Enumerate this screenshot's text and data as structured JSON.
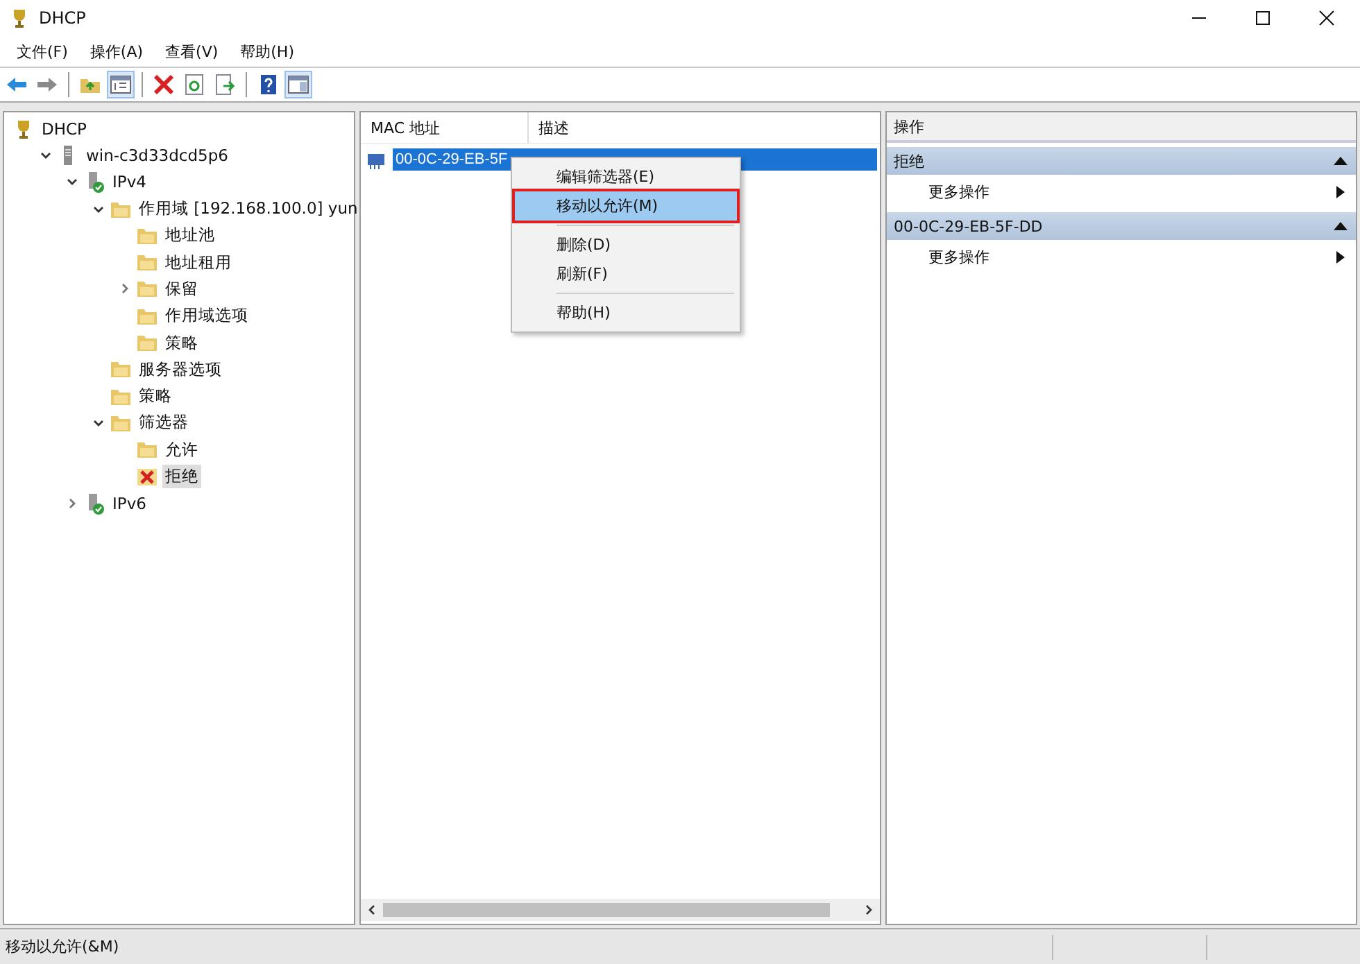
{
  "window": {
    "title": "DHCP"
  },
  "menu": [
    "文件(F)",
    "操作(A)",
    "查看(V)",
    "帮助(H)"
  ],
  "toolbar": [
    {
      "kind": "back",
      "pressed": false
    },
    {
      "kind": "forward",
      "pressed": false
    },
    {
      "kind": "sep"
    },
    {
      "kind": "up",
      "pressed": false
    },
    {
      "kind": "tree",
      "pressed": true
    },
    {
      "kind": "sep"
    },
    {
      "kind": "delete",
      "pressed": false
    },
    {
      "kind": "refresh",
      "pressed": false
    },
    {
      "kind": "export",
      "pressed": false
    },
    {
      "kind": "sep"
    },
    {
      "kind": "help",
      "pressed": false
    },
    {
      "kind": "pane",
      "pressed": true
    }
  ],
  "tree": [
    {
      "label": "DHCP",
      "kind": "root",
      "selected": false,
      "children": [
        {
          "label": "win-c3d33dcd5p6",
          "kind": "server",
          "selected": false,
          "expanded": true,
          "children": [
            {
              "label": "IPv4",
              "kind": "ip",
              "selected": false,
              "expanded": true,
              "children": [
                {
                  "label": "作用域 [192.168.100.0] yun",
                  "kind": "folder",
                  "selected": false,
                  "expanded": true,
                  "children": [
                    {
                      "label": "地址池",
                      "kind": "folder",
                      "selected": false
                    },
                    {
                      "label": "地址租用",
                      "kind": "folder",
                      "selected": false
                    },
                    {
                      "label": "保留",
                      "kind": "folder",
                      "selected": false,
                      "expanded": false
                    },
                    {
                      "label": "作用域选项",
                      "kind": "folder",
                      "selected": false
                    },
                    {
                      "label": "策略",
                      "kind": "folder",
                      "selected": false
                    }
                  ]
                },
                {
                  "label": "服务器选项",
                  "kind": "folder",
                  "selected": false
                },
                {
                  "label": "策略",
                  "kind": "folder",
                  "selected": false
                },
                {
                  "label": "筛选器",
                  "kind": "folder",
                  "selected": false,
                  "expanded": true,
                  "children": [
                    {
                      "label": "允许",
                      "kind": "folder",
                      "selected": false
                    },
                    {
                      "label": "拒绝",
                      "kind": "deny",
                      "selected": true
                    }
                  ]
                }
              ]
            },
            {
              "label": "IPv6",
              "kind": "ip",
              "selected": false,
              "expanded": false
            }
          ]
        }
      ]
    }
  ],
  "list": {
    "columns": [
      "MAC 地址",
      "描述"
    ],
    "rows": [
      {
        "mac": "00-0C-29-EB-5F",
        "selected": true
      }
    ]
  },
  "context_menu": [
    {
      "kind": "item",
      "label": "编辑筛选器(E)",
      "selected": false
    },
    {
      "kind": "item",
      "label": "移动以允许(M)",
      "selected": true
    },
    {
      "kind": "separator"
    },
    {
      "kind": "item",
      "label": "删除(D)",
      "selected": false
    },
    {
      "kind": "item",
      "label": "刷新(F)",
      "selected": false
    },
    {
      "kind": "separator"
    },
    {
      "kind": "item",
      "label": "帮助(H)",
      "selected": false
    }
  ],
  "actions": {
    "title": "操作",
    "sections": [
      {
        "title": "拒绝",
        "expanded": true,
        "items": [
          "更多操作"
        ]
      },
      {
        "title": "00-0C-29-EB-5F-DD",
        "expanded": true,
        "items": [
          "更多操作"
        ]
      }
    ]
  },
  "status_bar": "移动以允许(&M)"
}
